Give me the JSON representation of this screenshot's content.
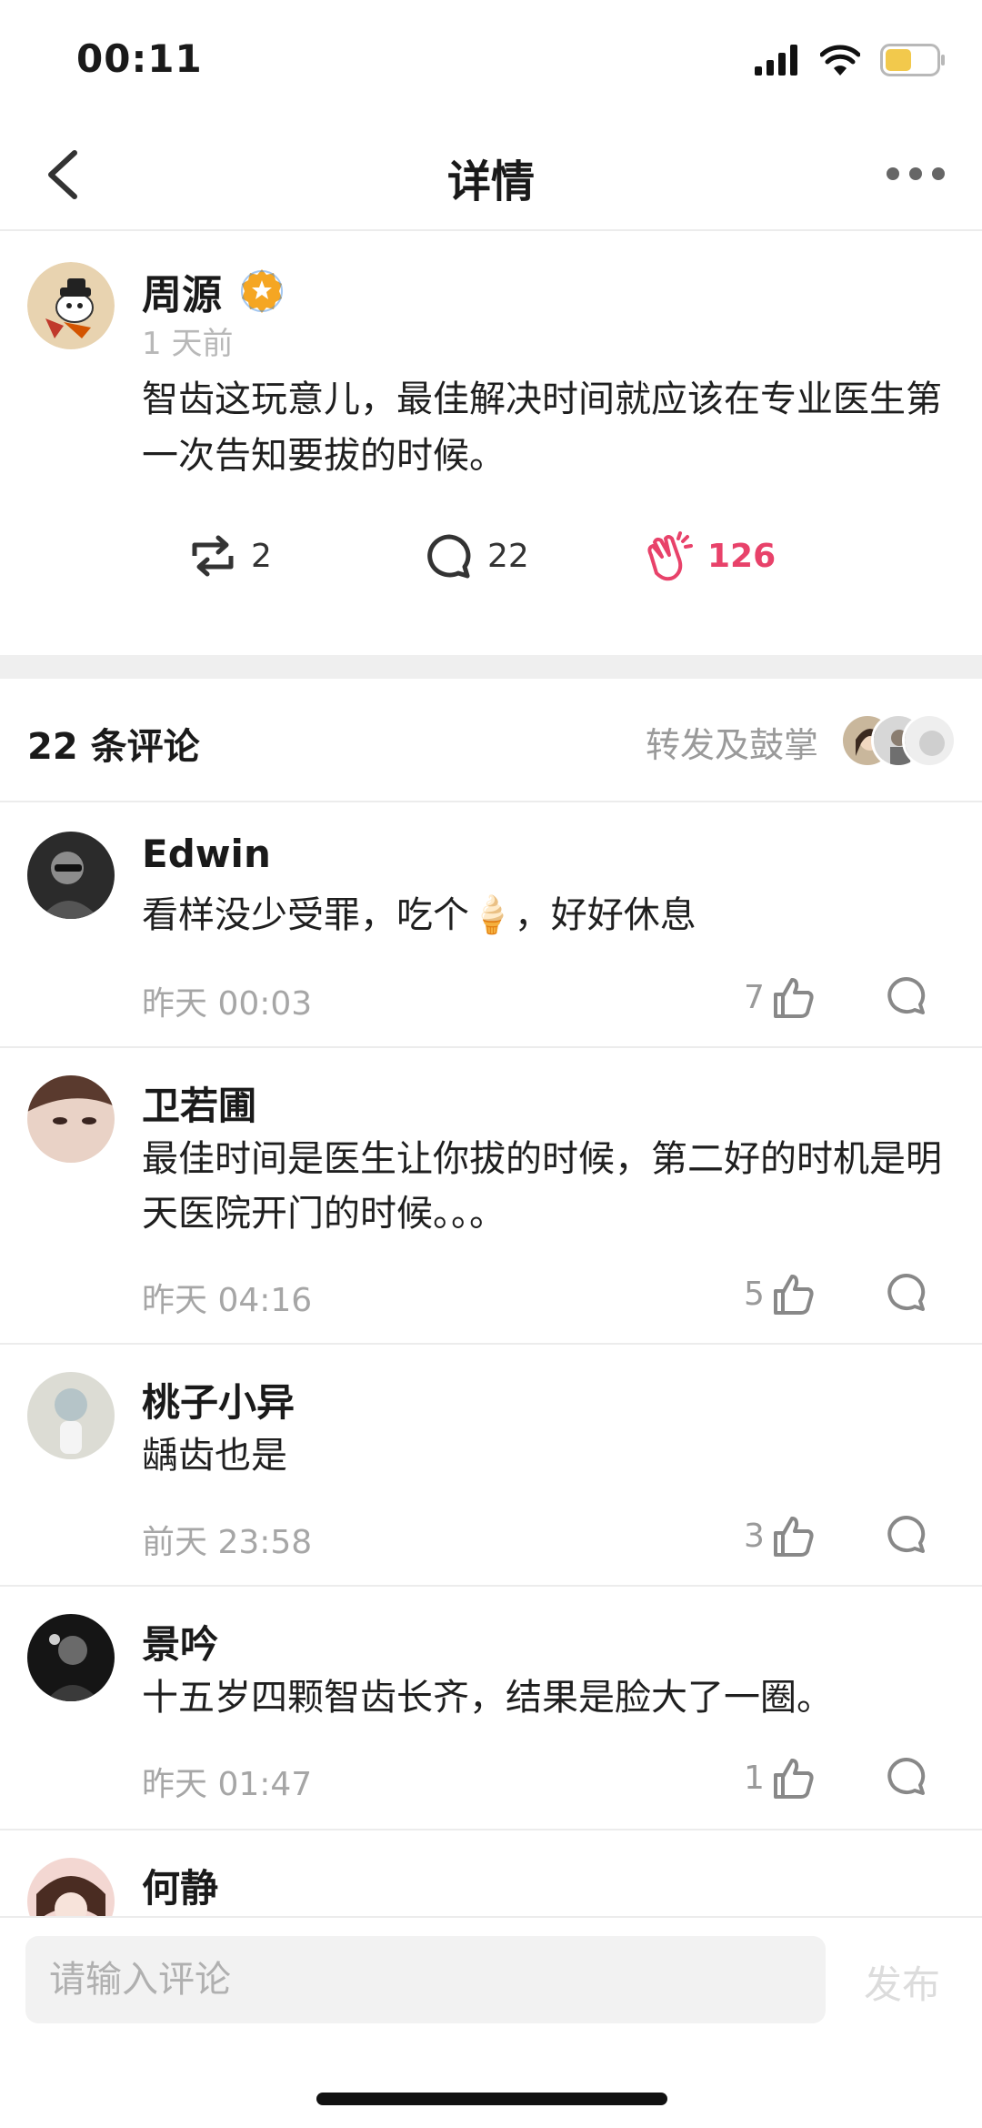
{
  "status": {
    "time": "00:11"
  },
  "nav": {
    "title": "详情"
  },
  "post": {
    "author": "周源",
    "time": "1 天前",
    "text": "智齿这玩意儿，最佳解决时间就应该在专业医生第一次告知要拔的时候。",
    "reposts": "2",
    "comments": "22",
    "claps": "126"
  },
  "comments_header": {
    "count_label": "22 条评论",
    "reposts_label": "转发及鼓掌"
  },
  "comments": [
    {
      "name": "Edwin",
      "text": "看样没少受罪，吃个🍦，好好休息",
      "time": "昨天 00:03",
      "likes": "7"
    },
    {
      "name": "卫若圃",
      "text": "最佳时间是医生让你拔的时候，第二好的时机是明天医院开门的时候。。。",
      "time": "昨天 04:16",
      "likes": "5"
    },
    {
      "name": "桃子小异",
      "text": "龋齿也是",
      "time": "前天 23:58",
      "likes": "3"
    },
    {
      "name": "景吟",
      "text": "十五岁四颗智齿长齐，结果是脸大了一圈。",
      "time": "昨天 01:47",
      "likes": "1"
    },
    {
      "name": "何静"
    }
  ],
  "input": {
    "placeholder": "请输入评论",
    "publish": "发布"
  },
  "colors": {
    "accent_clap": "#e8426a",
    "badge": "#f5a623",
    "battery": "#f2c94c"
  }
}
